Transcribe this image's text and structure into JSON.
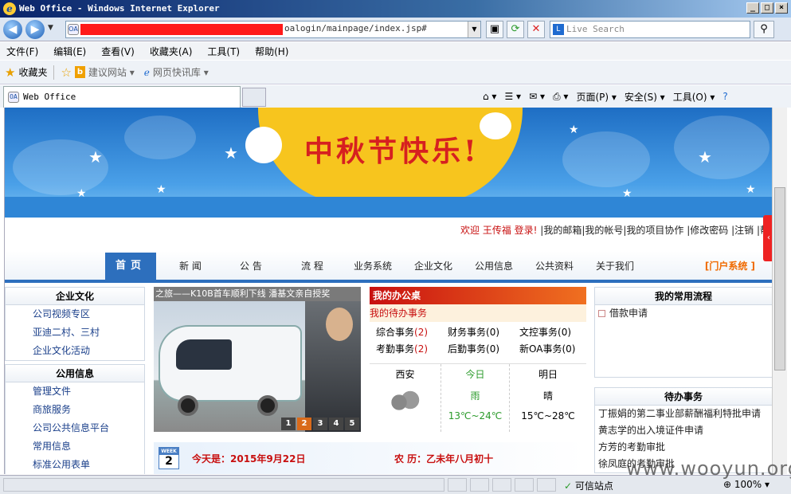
{
  "window": {
    "title": "Web Office - Windows Internet Explorer",
    "buttons": [
      "_",
      "□",
      "×"
    ]
  },
  "address": {
    "url_visible": "oalogin/mainpage/index.jsp#"
  },
  "search": {
    "placeholder": "Live Search"
  },
  "menu": [
    "文件(F)",
    "编辑(E)",
    "查看(V)",
    "收藏夹(A)",
    "工具(T)",
    "帮助(H)"
  ],
  "favbar": {
    "favorites": "收藏夹",
    "suggested": "建议网站 ▾",
    "webslice": "网页快讯库 ▾"
  },
  "tab": {
    "label": "Web Office"
  },
  "cmdbar": {
    "page": "页面(P) ▾",
    "safety": "安全(S) ▾",
    "tools": "工具(O) ▾",
    "help": "?"
  },
  "banner": {
    "title": "中秋节快乐!"
  },
  "welcome": {
    "greeting": "欢迎 王传福 登录!",
    "links": "|我的邮箱|我的帐号|我的项目协作 |修改密码 |注销 |帮"
  },
  "nav": {
    "active": "首页",
    "items": [
      "新 闻",
      "公 告",
      "流 程",
      "业务系统",
      "企业文化",
      "公用信息",
      "公共资料",
      "关于我们"
    ],
    "portal": "[门户系统 ]"
  },
  "left": {
    "culture": {
      "title": "企业文化",
      "items": [
        "公司视频专区",
        "亚迪二村、三村",
        "企业文化活动"
      ]
    },
    "public": {
      "title": "公用信息",
      "items": [
        "管理文件",
        "商旅服务",
        "公司公共信息平台",
        "常用信息",
        "标准公用表单"
      ]
    }
  },
  "slideshow": {
    "caption": "之旅——K10B首车顺利下线   潘基文亲自授奖",
    "pages": [
      "1",
      "2",
      "3",
      "4",
      "5"
    ],
    "current": "2"
  },
  "desk": {
    "title": "我的办公桌",
    "todo_label": "我的待办事务",
    "items": [
      {
        "label": "综合事务",
        "count": "(2)"
      },
      {
        "label": "财务事务",
        "count": "(0)"
      },
      {
        "label": "文控事务",
        "count": "(0)"
      },
      {
        "label": "考勤事务",
        "count": "(2)"
      },
      {
        "label": "后勤事务",
        "count": "(0)"
      },
      {
        "label": "新OA事务",
        "count": "(0)"
      }
    ]
  },
  "weather": {
    "city": "西安",
    "today_label": "今日",
    "tomorrow_label": "明日",
    "today_cond": "雨",
    "tomorrow_cond": "晴",
    "today_temp": "13℃~24℃",
    "tomorrow_temp": "15℃~28℃"
  },
  "datebar": {
    "cal_top": "WEEK",
    "cal_num": "2",
    "today": "今天是：2015年9月22日",
    "lunar": "农 历：乙未年八月初十"
  },
  "right": {
    "processes": {
      "title": "我的常用流程",
      "items": [
        "借款申请"
      ]
    },
    "pending": {
      "title": "待办事务",
      "items": [
        "丁振娟的第二事业部薪酬福利特批申请",
        "黄志学的出入境证件申请",
        "方芳的考勤审批",
        "徐凤庭的考勤审批"
      ]
    }
  },
  "status": {
    "trusted": "可信站点",
    "zoom": "100%"
  },
  "watermark": "www.wooyun.org"
}
